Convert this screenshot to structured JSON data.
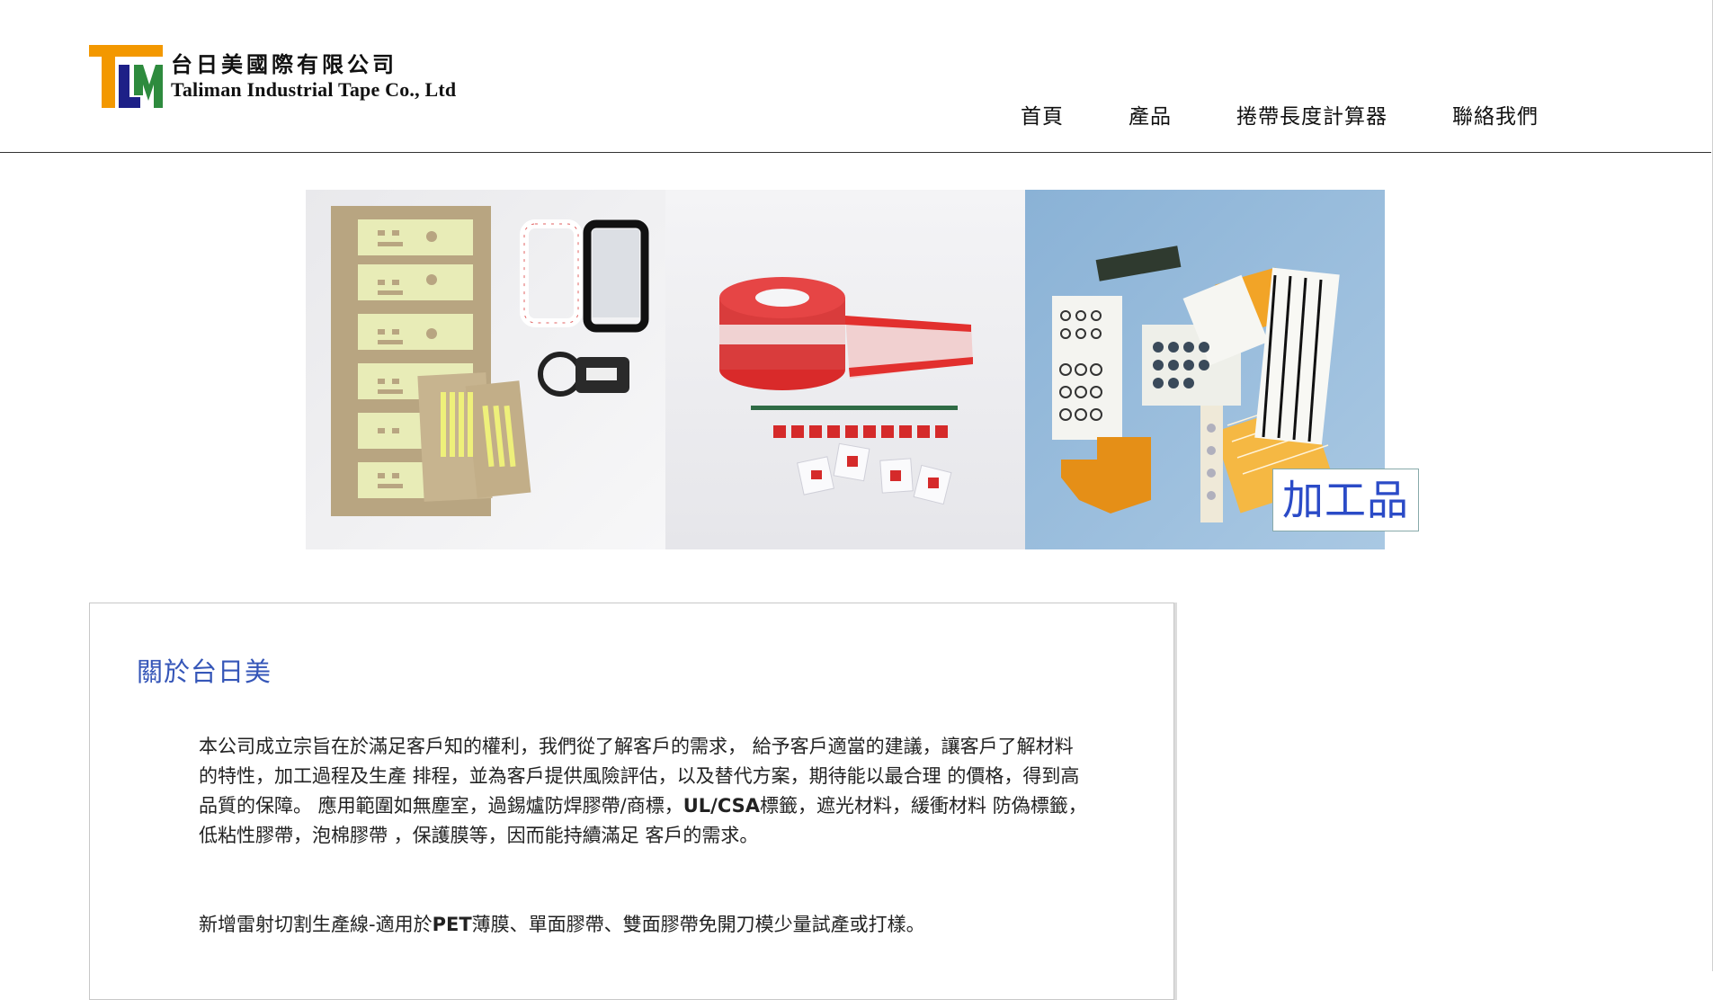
{
  "brand": {
    "name_zh": "台日美國際有限公司",
    "name_en": "Taliman Industrial Tape Co., Ltd",
    "logo_colors": {
      "orange": "#f39800",
      "navy": "#1d2087",
      "green": "#2e8b3e"
    }
  },
  "nav": {
    "items": [
      {
        "label": "首頁"
      },
      {
        "label": "產品"
      },
      {
        "label": "捲帶長度計算器"
      },
      {
        "label": "聯絡我們"
      }
    ]
  },
  "banner": {
    "caption": "加工品",
    "accent_color": "#2b4bc7"
  },
  "about": {
    "title": "關於台日美",
    "paragraph1": {
      "part1": "本公司成立宗旨在於滿足客戶知的權利，我們從了解客戶的需求， 給予客戶適當的建議，讓客戶了解材料的特性，加工過程及生產 排程，並為客戶提供風險評估，以及替代方案，期待能以最合理 的價格，得到高品質的保障。 應用範圍如無塵室，過錫爐防焊膠帶/商標，",
      "bold": "UL/CSA",
      "part2": "標籤，遮光材料，緩衝材料 防偽標籤，低粘性膠帶，泡棉膠帶 ，保護膜等，因而能持續滿足 客戶的需求。"
    },
    "paragraph2": {
      "part1": "新增雷射切割生產線-適用於",
      "bold": "PET",
      "part2": "薄膜、單面膠帶、雙面膠帶免開刀模少量試產或打樣。"
    }
  }
}
